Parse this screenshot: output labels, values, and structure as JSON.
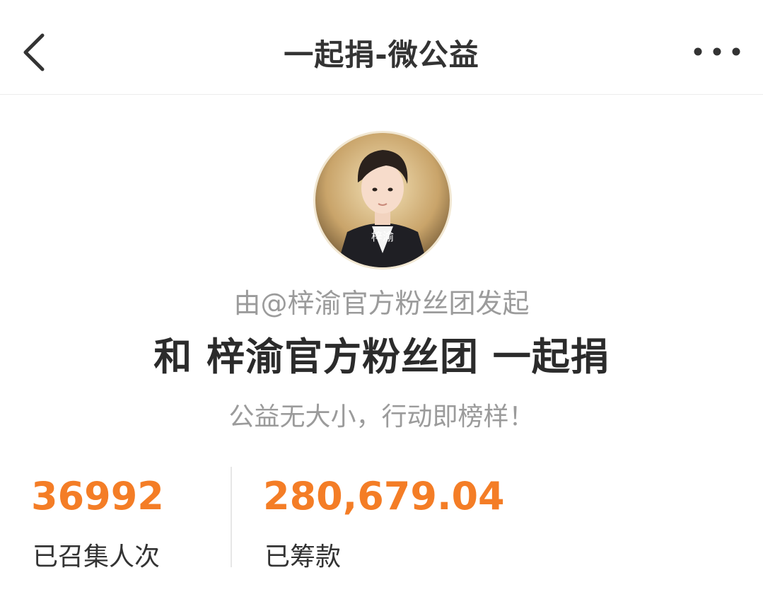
{
  "nav": {
    "title": "一起捐-微公益",
    "back_icon": "chevron-left-icon",
    "more_icon": "more-dots-icon"
  },
  "avatar": {
    "caption": "梓渝"
  },
  "campaign": {
    "initiator": "由@梓渝官方粉丝团发起",
    "headline": "和 梓渝官方粉丝团 一起捐",
    "slogan": "公益无大小，行动即榜样！"
  },
  "stats": {
    "participants_value": "36992",
    "participants_label": "已召集人次",
    "raised_value": "280,679.04",
    "raised_label": "已筹款"
  },
  "colors": {
    "accent": "#f47d26",
    "muted_text": "#9b9b9b",
    "primary_text": "#2b2b2b"
  }
}
